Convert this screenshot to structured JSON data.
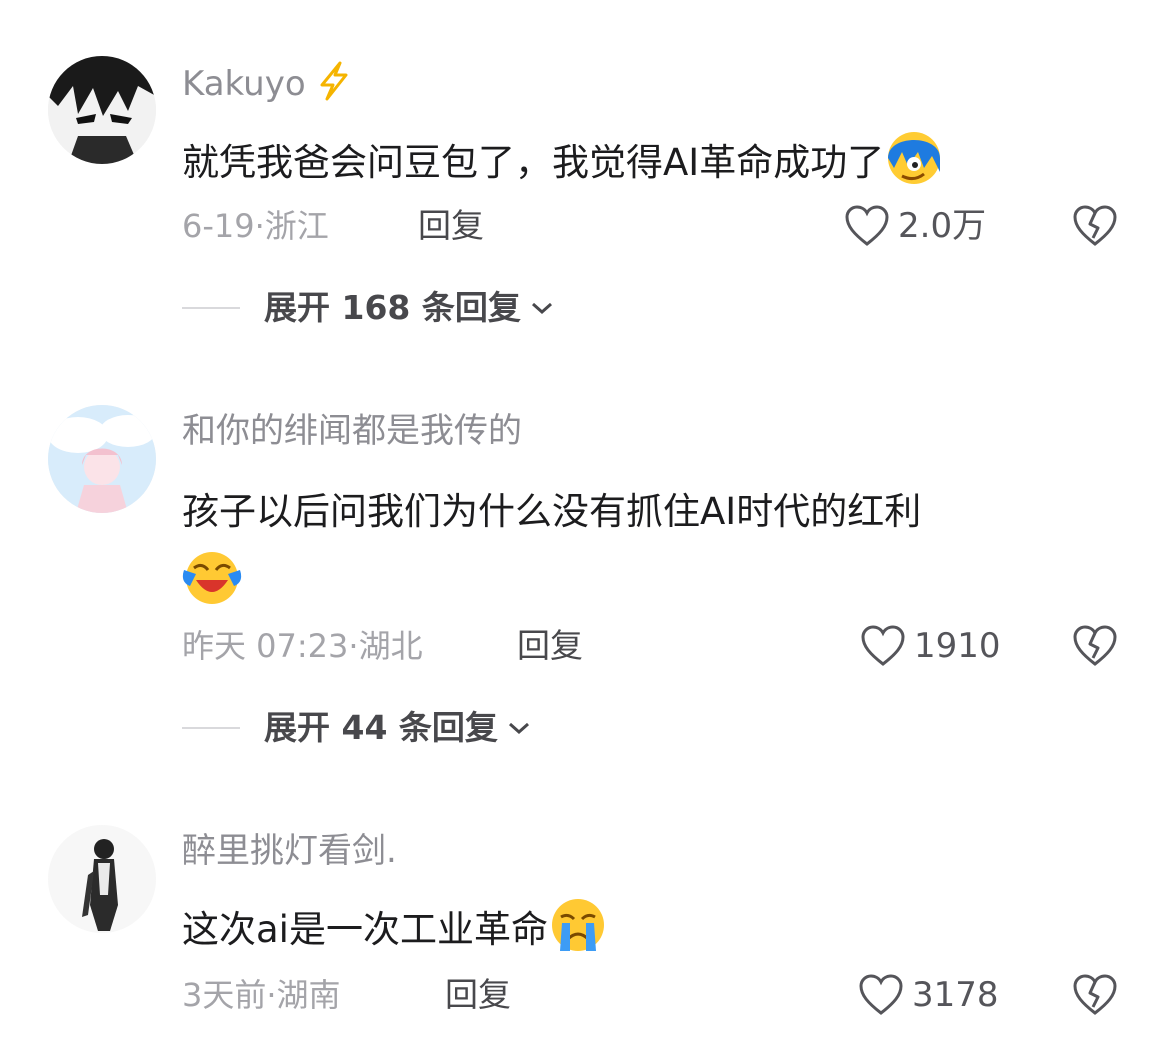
{
  "comments": [
    {
      "username": "Kakuyo",
      "user_badge": "lightning-icon",
      "text": "就凭我爸会问豆包了，我觉得AI革命成功了",
      "text_emoji": "blue-hair-face-emoji",
      "date": "6-19",
      "location": "浙江",
      "reply_label": "回复",
      "likes": "2.0万",
      "expand_label": "展开 168 条回复"
    },
    {
      "username": "和你的绯闻都是我传的",
      "text": "孩子以后问我们为什么没有抓住AI时代的红利",
      "text_emoji": "crying-laughing-emoji",
      "date": "昨天 07:23",
      "location": "湖北",
      "reply_label": "回复",
      "likes": "1910",
      "expand_label": "展开 44 条回复"
    },
    {
      "username": "醉里挑灯看剑.",
      "text": "这次ai是一次工业革命",
      "text_emoji": "crying-emoji",
      "date": "3天前",
      "location": "湖南",
      "reply_label": "回复",
      "likes": "3178"
    }
  ],
  "meta_separator": "·"
}
